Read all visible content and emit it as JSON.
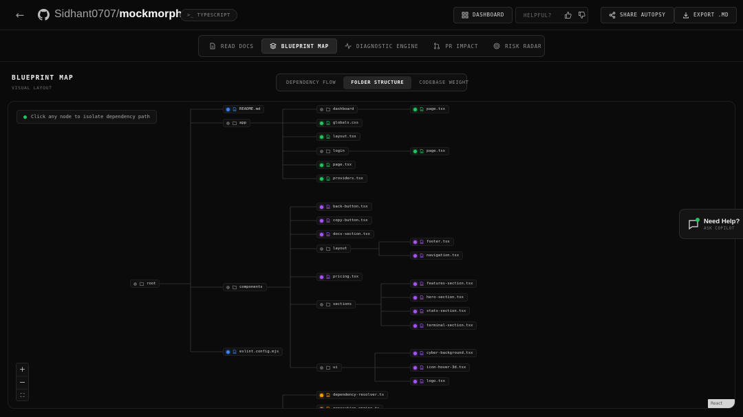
{
  "header": {
    "repo_owner": "Sidhant0707/",
    "repo_name": "mockmorph",
    "language_prompt": ">_",
    "language": "TYPESCRIPT",
    "dashboard_label": "DASHBOARD",
    "helpful_label": "HELPFUL?",
    "share_label": "SHARE AUTOPSY",
    "export_label": "EXPORT .MD",
    "icons": [
      "back-arrow-icon",
      "github-icon",
      "grid-icon",
      "thumbs-up-icon",
      "thumbs-down-icon",
      "share-icon",
      "download-icon"
    ]
  },
  "tabs": [
    {
      "label": "READ DOCS",
      "icon": "doc-icon"
    },
    {
      "label": "BLUEPRINT MAP",
      "icon": "layers-icon",
      "active": true
    },
    {
      "label": "DIAGNOSTIC ENGINE",
      "icon": "pulse-icon"
    },
    {
      "label": "PR IMPACT",
      "icon": "git-pull-request-icon"
    },
    {
      "label": "RISK RADAR",
      "icon": "radar-icon"
    }
  ],
  "section": {
    "title": "BLUEPRINT MAP",
    "subtitle": "VISUAL LAYOUT"
  },
  "view_tabs": [
    {
      "label": "DEPENDENCY FLOW"
    },
    {
      "label": "FOLDER STRUCTURE",
      "active": true
    },
    {
      "label": "CODEBASE WEIGHT"
    }
  ],
  "canvas": {
    "hint": "Click any node to isolate dependency path",
    "zoom_in": "+",
    "zoom_out": "−",
    "fit": "⛶",
    "attribution": "React Flow",
    "colors": {
      "folder": "#7a7a7a",
      "md": "#3b82f6",
      "css": "#22c55e",
      "tsx": "#22c55e",
      "component": "#a855f7",
      "ts": "#f59e0b"
    }
  },
  "tree": [
    {
      "id": "root",
      "label": "root",
      "kind": "folder"
    },
    {
      "id": "readme",
      "label": "README.md",
      "kind": "md",
      "parent": "root"
    },
    {
      "id": "app",
      "label": "app",
      "kind": "folder",
      "parent": "root"
    },
    {
      "id": "dashboard",
      "label": "dashboard",
      "kind": "folder",
      "parent": "app"
    },
    {
      "id": "dash_page",
      "label": "page.tsx",
      "kind": "tsx",
      "parent": "dashboard"
    },
    {
      "id": "globals",
      "label": "globals.css",
      "kind": "css",
      "parent": "app"
    },
    {
      "id": "layout_tsx",
      "label": "layout.tsx",
      "kind": "tsx",
      "parent": "app"
    },
    {
      "id": "login",
      "label": "login",
      "kind": "folder",
      "parent": "app"
    },
    {
      "id": "login_page",
      "label": "page.tsx",
      "kind": "tsx",
      "parent": "login"
    },
    {
      "id": "app_page",
      "label": "page.tsx",
      "kind": "tsx",
      "parent": "app"
    },
    {
      "id": "providers",
      "label": "providers.tsx",
      "kind": "tsx",
      "parent": "app"
    },
    {
      "id": "components",
      "label": "components",
      "kind": "folder",
      "parent": "root"
    },
    {
      "id": "back_btn",
      "label": "back-button.tsx",
      "kind": "component",
      "parent": "components"
    },
    {
      "id": "copy_btn",
      "label": "copy-button.tsx",
      "kind": "component",
      "parent": "components"
    },
    {
      "id": "docs_sec",
      "label": "docs-section.tsx",
      "kind": "component",
      "parent": "components"
    },
    {
      "id": "layout_f",
      "label": "layout",
      "kind": "folder",
      "parent": "components"
    },
    {
      "id": "footer",
      "label": "footer.tsx",
      "kind": "component",
      "parent": "layout_f"
    },
    {
      "id": "navigation",
      "label": "navigation.tsx",
      "kind": "component",
      "parent": "layout_f"
    },
    {
      "id": "pricing",
      "label": "pricing.tsx",
      "kind": "component",
      "parent": "components"
    },
    {
      "id": "sections",
      "label": "sections",
      "kind": "folder",
      "parent": "components"
    },
    {
      "id": "features",
      "label": "features-section.tsx",
      "kind": "component",
      "parent": "sections"
    },
    {
      "id": "hero",
      "label": "hero-section.tsx",
      "kind": "component",
      "parent": "sections"
    },
    {
      "id": "stats",
      "label": "stats-section.tsx",
      "kind": "component",
      "parent": "sections"
    },
    {
      "id": "terminal",
      "label": "terminal-section.tsx",
      "kind": "component",
      "parent": "sections"
    },
    {
      "id": "ui",
      "label": "ui",
      "kind": "folder",
      "parent": "components"
    },
    {
      "id": "cyber",
      "label": "cyber-background.tsx",
      "kind": "component",
      "parent": "ui"
    },
    {
      "id": "iconhover",
      "label": "icon-hover-3d.tsx",
      "kind": "component",
      "parent": "ui"
    },
    {
      "id": "logo",
      "label": "logo.tsx",
      "kind": "component",
      "parent": "ui"
    },
    {
      "id": "eslint",
      "label": "eslint.config.mjs",
      "kind": "md",
      "parent": "root"
    },
    {
      "id": "dep_res",
      "label": "dependency-resolver.ts",
      "kind": "ts",
      "parent": "lib"
    },
    {
      "id": "gen_eng",
      "label": "generation-engine.ts",
      "kind": "ts",
      "parent": "lib"
    }
  ],
  "help": {
    "title": "Need Help?",
    "subtitle": "ASK COPILOT"
  }
}
